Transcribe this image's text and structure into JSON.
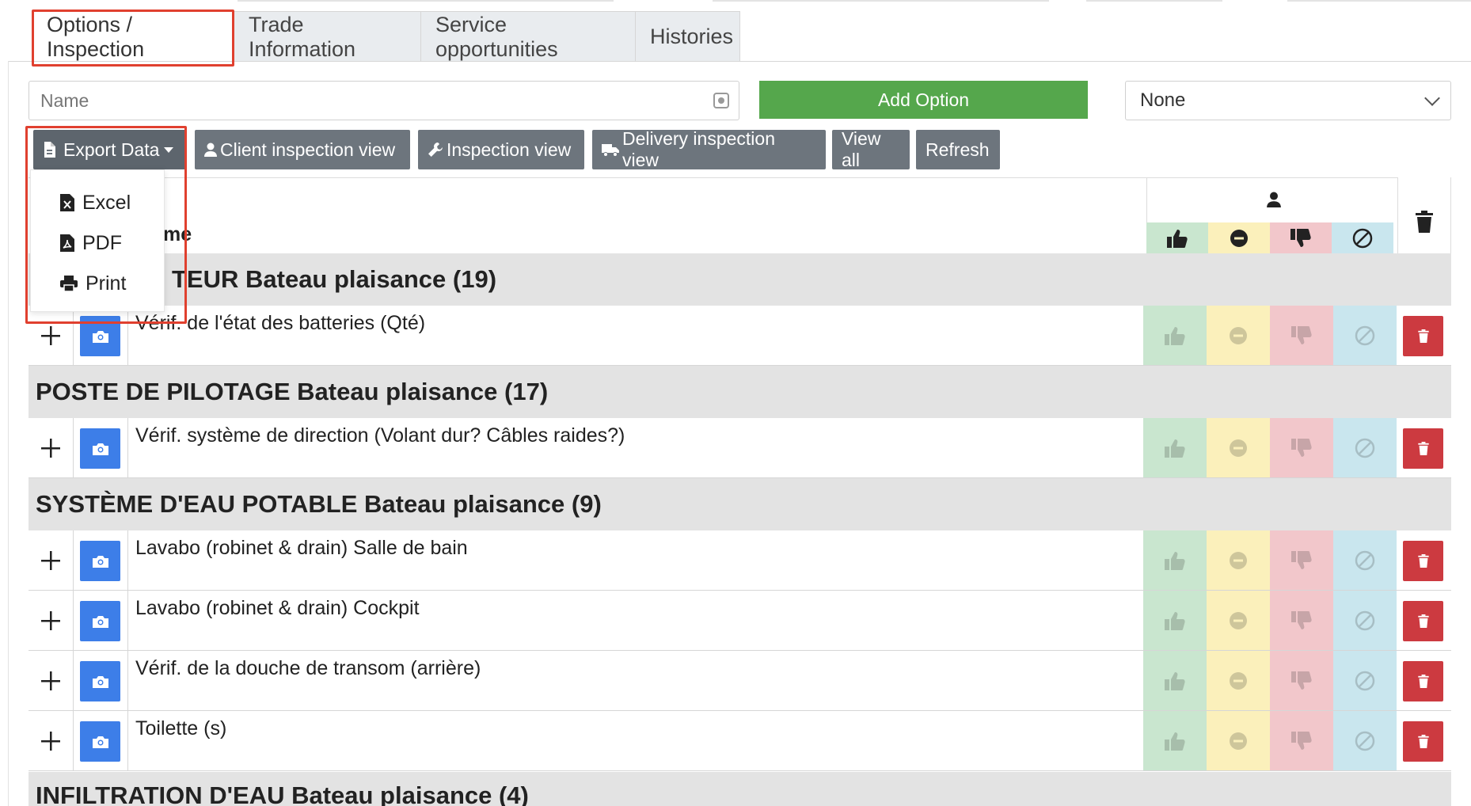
{
  "tabs": [
    {
      "label": "Options / Inspection"
    },
    {
      "label": "Trade Information"
    },
    {
      "label": "Service opportunities"
    },
    {
      "label": "Histories"
    }
  ],
  "name_input": {
    "placeholder": "Name"
  },
  "add_option": {
    "label": "Add Option"
  },
  "filter_select": {
    "value": "None"
  },
  "toolbar": {
    "export": "Export Data",
    "client_view": "Client inspection view",
    "inspection_view": "Inspection view",
    "delivery_view": "Delivery inspection view",
    "view_all": "View all",
    "refresh": "Refresh"
  },
  "export_menu": [
    {
      "label": "Excel",
      "icon": "excel-file-icon"
    },
    {
      "label": "PDF",
      "icon": "pdf-file-icon"
    },
    {
      "label": "Print",
      "icon": "printer-icon"
    }
  ],
  "table": {
    "name_header_partial": "me",
    "status_colors": {
      "good": "#c9e6cf",
      "neutral": "#fbf0bb",
      "bad": "#f2c7cb",
      "na": "#c9e6ee"
    }
  },
  "sections": [
    {
      "title": "TEUR Bateau plaisance (19)",
      "items": [
        {
          "label": "Vérif. de l'état des batteries (Qté)"
        }
      ]
    },
    {
      "title": "POSTE DE PILOTAGE Bateau plaisance (17)",
      "items": [
        {
          "label": "Vérif. système de direction (Volant dur? Câbles raides?)"
        }
      ]
    },
    {
      "title": "SYSTÈME D'EAU POTABLE Bateau plaisance (9)",
      "items": [
        {
          "label": "Lavabo (robinet & drain) Salle de bain"
        },
        {
          "label": "Lavabo (robinet & drain) Cockpit"
        },
        {
          "label": "Vérif. de la douche de transom (arrière)"
        },
        {
          "label": "Toilette (s)"
        }
      ]
    },
    {
      "title": "INFILTRATION D'EAU Bateau plaisance (4)",
      "items": []
    }
  ],
  "colors": {
    "add_green": "#55a74c",
    "toolbar_gray": "#6d757d",
    "camera_blue": "#3d7ee8",
    "delete_red": "#cc3a40",
    "highlight_red": "#e0402f"
  }
}
